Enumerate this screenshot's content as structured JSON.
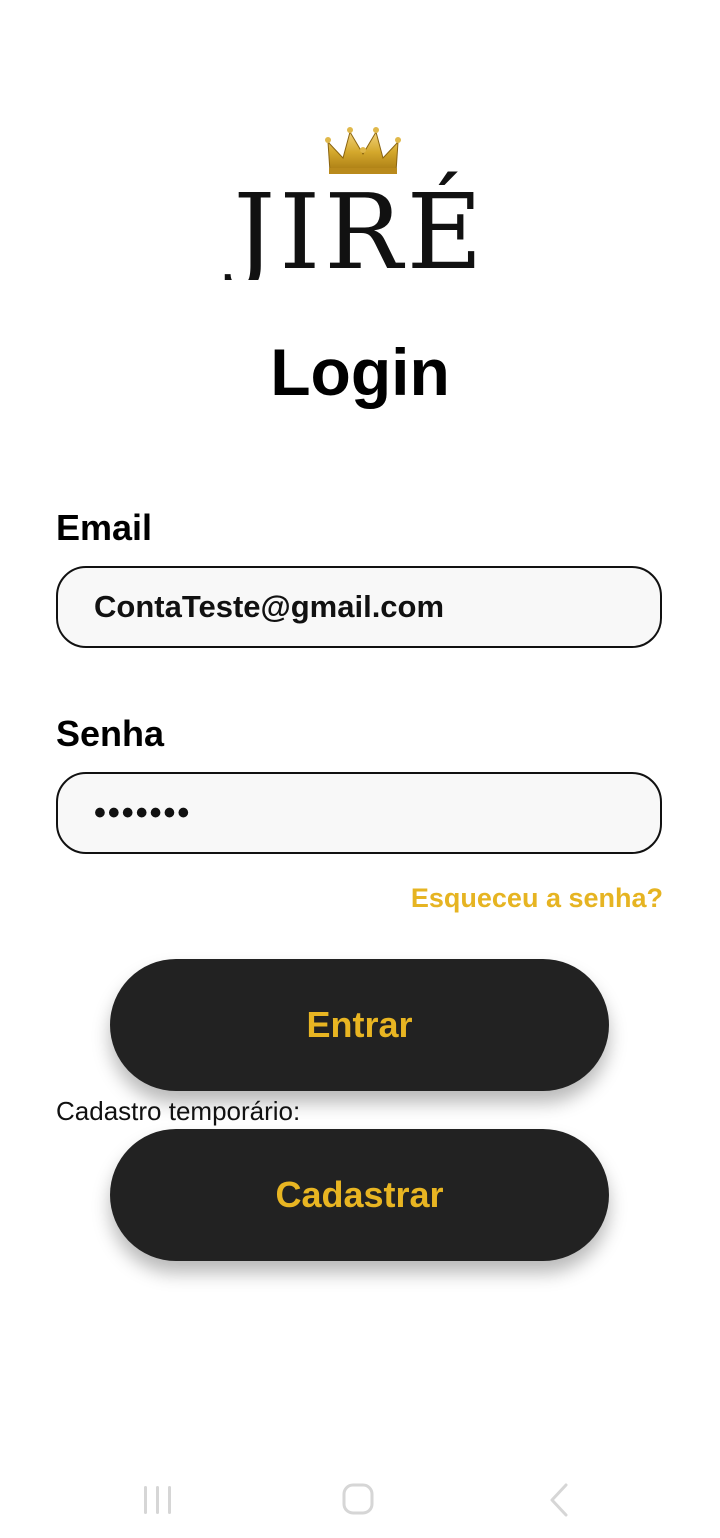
{
  "logo": {
    "text": "JIRÉ",
    "crown_color": "#d4a82c"
  },
  "title": "Login",
  "email": {
    "label": "Email",
    "value": "ContaTeste@gmail.com"
  },
  "password": {
    "label": "Senha",
    "value": "•••••••"
  },
  "forgot_link": "Esqueceu a senha?",
  "login_button": "Entrar",
  "temp_signup_label": "Cadastro temporário:",
  "signup_button": "Cadastrar",
  "navbar": {
    "icons": [
      "recent-apps-icon",
      "home-icon",
      "back-icon"
    ]
  },
  "colors": {
    "accent": "#e8b522",
    "button_bg": "#222222",
    "field_bg": "#f8f8f8"
  }
}
